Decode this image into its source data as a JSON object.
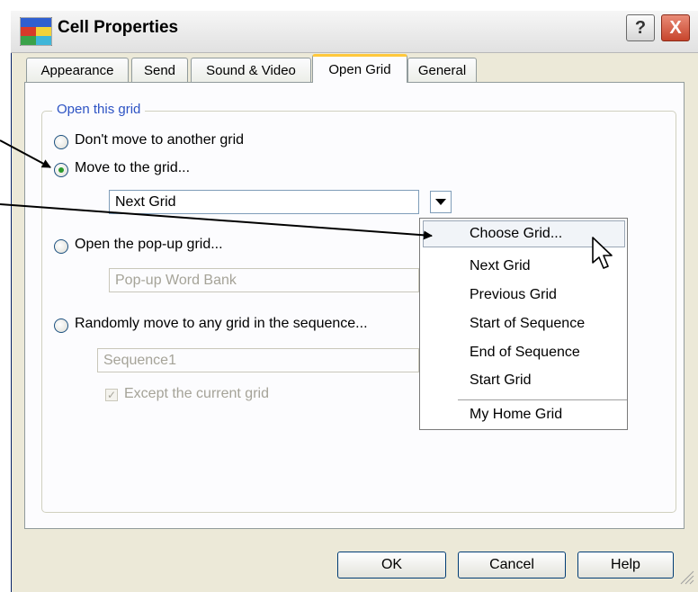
{
  "window": {
    "title": "Cell Properties",
    "help_glyph": "?",
    "close_glyph": "X"
  },
  "tabs": [
    {
      "label": "Appearance",
      "active": false
    },
    {
      "label": "Send",
      "active": false
    },
    {
      "label": "Sound & Video",
      "active": false
    },
    {
      "label": "Open Grid",
      "active": true
    },
    {
      "label": "General",
      "active": false
    }
  ],
  "group": {
    "label": "Open this grid",
    "options": [
      {
        "label": "Don't move to another grid",
        "checked": false
      },
      {
        "label": "Move to the grid...",
        "checked": true
      },
      {
        "label": "Open the pop-up grid...",
        "checked": false
      },
      {
        "label": "Randomly move to any grid in the sequence...",
        "checked": false
      }
    ],
    "grid_combo_value": "Next Grid",
    "popup_combo_value": "Pop-up Word Bank",
    "sequence_combo_value": "Sequence1",
    "except_current": {
      "label": "Except the current grid",
      "checked": true,
      "enabled": false
    }
  },
  "dropdown": {
    "items": [
      "Choose Grid...",
      "Next Grid",
      "Previous Grid",
      "Start of Sequence",
      "End of Sequence",
      "Start Grid",
      "My Home Grid"
    ],
    "highlighted": "Choose Grid..."
  },
  "buttons": {
    "ok": "OK",
    "cancel": "Cancel",
    "help": "Help"
  },
  "colors": {
    "dialog_bg": "#ece9d8",
    "panel_bg": "#fcfcfe",
    "group_label": "#2d53c4",
    "active_tab_accent": "#ffc83c",
    "radio_dot": "#2c9a2c"
  }
}
